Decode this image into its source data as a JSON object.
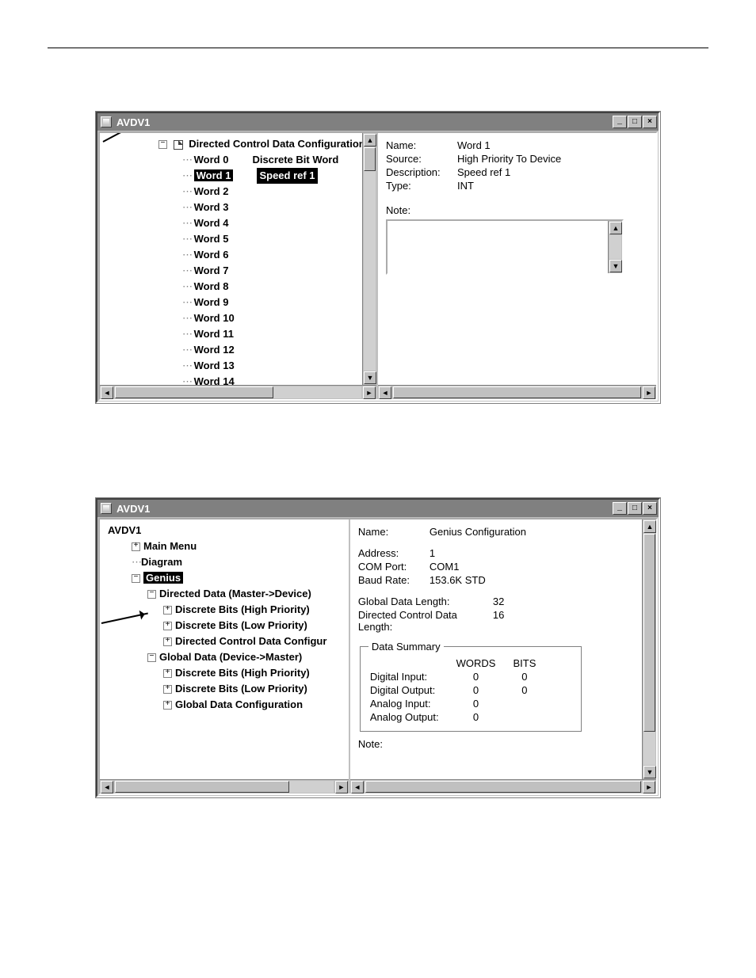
{
  "window1": {
    "title": "AVDV1",
    "tree_header": "Directed Control Data Configuration",
    "words": [
      {
        "label": "Word 0",
        "desc": "Discrete Bit Word",
        "selected": false
      },
      {
        "label": "Word 1",
        "desc": "Speed ref 1",
        "selected": true
      },
      {
        "label": "Word 2",
        "desc": "",
        "selected": false
      },
      {
        "label": "Word 3",
        "desc": "",
        "selected": false
      },
      {
        "label": "Word 4",
        "desc": "",
        "selected": false
      },
      {
        "label": "Word 5",
        "desc": "",
        "selected": false
      },
      {
        "label": "Word 6",
        "desc": "",
        "selected": false
      },
      {
        "label": "Word 7",
        "desc": "",
        "selected": false
      },
      {
        "label": "Word 8",
        "desc": "",
        "selected": false
      },
      {
        "label": "Word 9",
        "desc": "",
        "selected": false
      },
      {
        "label": "Word 10",
        "desc": "",
        "selected": false
      },
      {
        "label": "Word 11",
        "desc": "",
        "selected": false
      },
      {
        "label": "Word 12",
        "desc": "",
        "selected": false
      },
      {
        "label": "Word 13",
        "desc": "",
        "selected": false
      },
      {
        "label": "Word 14",
        "desc": "",
        "selected": false
      }
    ],
    "details": {
      "name_label": "Name:",
      "name_value": "Word 1",
      "source_label": "Source:",
      "source_value": "High Priority To Device",
      "description_label": "Description:",
      "description_value": "Speed ref 1",
      "type_label": "Type:",
      "type_value": "INT",
      "note_label": "Note:"
    }
  },
  "window2": {
    "title": "AVDV1",
    "tree": {
      "root": "AVDV1",
      "main_menu": "Main Menu",
      "diagram": "Diagram",
      "genius": "Genius",
      "directed_data": "Directed Data (Master->Device)",
      "db_high_1": "Discrete Bits (High Priority)",
      "db_low_1": "Discrete Bits (Low Priority)",
      "dcdc": "Directed Control Data Configur",
      "global_data": "Global Data (Device->Master)",
      "db_high_2": "Discrete Bits (High Priority)",
      "db_low_2": "Discrete Bits (Low Priority)",
      "gdc": "Global Data Configuration"
    },
    "details": {
      "name_label": "Name:",
      "name_value": "Genius Configuration",
      "address_label": "Address:",
      "address_value": "1",
      "comport_label": "COM Port:",
      "comport_value": "COM1",
      "baud_label": "Baud Rate:",
      "baud_value": "153.6K STD",
      "gdl_label": "Global Data Length:",
      "gdl_value": "32",
      "dcdl_label": "Directed Control Data Length:",
      "dcdl_value": "16",
      "ds_legend": "Data Summary",
      "col_words": "WORDS",
      "col_bits": "BITS",
      "di_label": "Digital Input:",
      "di_words": "0",
      "di_bits": "0",
      "do_label": "Digital Output:",
      "do_words": "0",
      "do_bits": "0",
      "ai_label": "Analog Input:",
      "ai_words": "0",
      "ao_label": "Analog Output:",
      "ao_words": "0",
      "note_label": "Note:"
    }
  }
}
